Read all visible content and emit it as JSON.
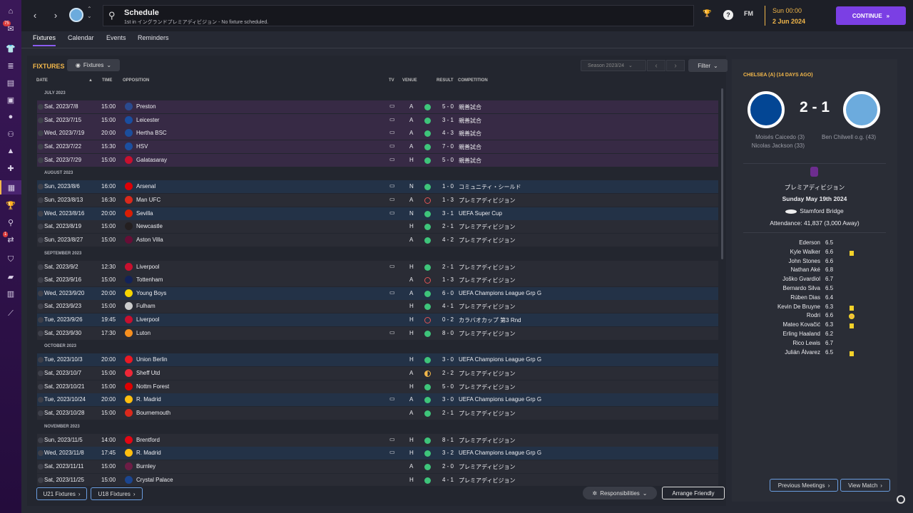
{
  "sidebar": {
    "items": [
      {
        "icon": "home-icon",
        "glyph": "⌂"
      },
      {
        "icon": "inbox-icon",
        "glyph": "✉",
        "badge": "75"
      },
      {
        "icon": "squad-icon",
        "glyph": "👕"
      },
      {
        "icon": "tactics-icon",
        "glyph": "≣"
      },
      {
        "icon": "data-hub-icon",
        "glyph": "▤"
      },
      {
        "icon": "staff-icon",
        "glyph": "▣"
      },
      {
        "icon": "training-icon",
        "glyph": "●"
      },
      {
        "icon": "recruitment-icon",
        "glyph": "⚇"
      },
      {
        "icon": "medical-icon",
        "glyph": "▲"
      },
      {
        "icon": "dev-center-icon",
        "glyph": "✚"
      },
      {
        "icon": "schedule-icon",
        "glyph": "▦",
        "active": true
      },
      {
        "icon": "competitions-icon",
        "glyph": "🏆"
      },
      {
        "icon": "scouting-icon",
        "glyph": "⚲"
      },
      {
        "icon": "transfers-icon",
        "glyph": "⇄",
        "badge": "1"
      },
      {
        "icon": "club-info-icon",
        "glyph": "⛉"
      },
      {
        "icon": "finances-icon",
        "glyph": "▰"
      },
      {
        "icon": "club-vision-icon",
        "glyph": "▥"
      },
      {
        "icon": "tutorial-icon",
        "glyph": "⟋"
      }
    ]
  },
  "topbar": {
    "title": "Schedule",
    "subtitle": "1st in イングランドプレミアディビジョン - No fixture scheduled.",
    "fm_label": "FM",
    "time": "Sun 00:00",
    "date": "2 Jun 2024",
    "continue_label": "CONTINUE"
  },
  "tabs": [
    {
      "label": "Fixtures",
      "active": true
    },
    {
      "label": "Calendar"
    },
    {
      "label": "Events"
    },
    {
      "label": "Reminders"
    }
  ],
  "fixtures": {
    "title": "FIXTURES",
    "view_dropdown": "Fixtures",
    "season": "Season 2023/24",
    "filter_label": "Filter",
    "columns": {
      "date": "DATE",
      "time": "TIME",
      "opposition": "OPPOSITION",
      "tv": "TV",
      "venue": "VENUE",
      "result": "RESULT",
      "competition": "COMPETITION"
    },
    "rows": [
      {
        "type": "month",
        "label": "JULY 2023"
      },
      {
        "date": "Sat, 2023/7/8",
        "time": "15:00",
        "opp": "Preston",
        "tv": true,
        "venue": "A",
        "res": "W",
        "score": "5 - 0",
        "comp": "親善試合",
        "cat": "pre",
        "crest": "#2b4a8e"
      },
      {
        "date": "Sat, 2023/7/15",
        "time": "15:00",
        "opp": "Leicester",
        "tv": true,
        "venue": "A",
        "res": "W",
        "score": "3 - 1",
        "comp": "親善試合",
        "cat": "pre",
        "crest": "#1a4ea0"
      },
      {
        "date": "Wed, 2023/7/19",
        "time": "20:00",
        "opp": "Hertha BSC",
        "tv": true,
        "venue": "A",
        "res": "W",
        "score": "4 - 3",
        "comp": "親善試合",
        "cat": "pre",
        "crest": "#1c4e9c"
      },
      {
        "date": "Sat, 2023/7/22",
        "time": "15:30",
        "opp": "HSV",
        "tv": true,
        "venue": "A",
        "res": "W",
        "score": "7 - 0",
        "comp": "親善試合",
        "cat": "pre",
        "crest": "#1c4fa0"
      },
      {
        "date": "Sat, 2023/7/29",
        "time": "15:00",
        "opp": "Galatasaray",
        "tv": true,
        "venue": "H",
        "res": "W",
        "score": "5 - 0",
        "comp": "親善試合",
        "cat": "pre",
        "crest": "#c8102e"
      },
      {
        "type": "month",
        "label": "AUGUST 2023"
      },
      {
        "date": "Sun, 2023/8/6",
        "time": "16:00",
        "opp": "Arsenal",
        "tv": true,
        "venue": "N",
        "res": "W",
        "score": "1 - 0",
        "comp": "コミュニティ・シールド",
        "cat": "cs",
        "crest": "#db0007"
      },
      {
        "date": "Sun, 2023/8/13",
        "time": "16:30",
        "opp": "Man UFC",
        "tv": true,
        "venue": "A",
        "res": "L",
        "score": "1 - 3",
        "comp": "プレミアディビジョン",
        "cat": "def",
        "crest": "#da291c"
      },
      {
        "date": "Wed, 2023/8/16",
        "time": "20:00",
        "opp": "Sevilla",
        "tv": true,
        "venue": "N",
        "res": "W",
        "score": "3 - 1",
        "comp": "UEFA Super Cup",
        "cat": "cs",
        "crest": "#d81e05"
      },
      {
        "date": "Sat, 2023/8/19",
        "time": "15:00",
        "opp": "Newcastle",
        "tv": false,
        "venue": "H",
        "res": "W",
        "score": "2 - 1",
        "comp": "プレミアディビジョン",
        "cat": "def",
        "crest": "#241f20"
      },
      {
        "date": "Sun, 2023/8/27",
        "time": "15:00",
        "opp": "Aston Villa",
        "tv": false,
        "venue": "A",
        "res": "W",
        "score": "4 - 2",
        "comp": "プレミアディビジョン",
        "cat": "def",
        "crest": "#670e36"
      },
      {
        "type": "month",
        "label": "SEPTEMBER 2023"
      },
      {
        "date": "Sat, 2023/9/2",
        "time": "12:30",
        "opp": "Liverpool",
        "tv": true,
        "venue": "H",
        "res": "W",
        "score": "2 - 1",
        "comp": "プレミアディビジョン",
        "cat": "def",
        "crest": "#c8102e"
      },
      {
        "date": "Sat, 2023/9/16",
        "time": "15:00",
        "opp": "Tottenham",
        "tv": false,
        "venue": "A",
        "res": "L",
        "score": "1 - 3",
        "comp": "プレミアディビジョン",
        "cat": "def",
        "crest": "#132257"
      },
      {
        "date": "Wed, 2023/9/20",
        "time": "20:00",
        "opp": "Young Boys",
        "tv": true,
        "venue": "A",
        "res": "W",
        "score": "6 - 0",
        "comp": "UEFA Champions League Grp G",
        "cat": "cs",
        "crest": "#f6d500"
      },
      {
        "date": "Sat, 2023/9/23",
        "time": "15:00",
        "opp": "Fulham",
        "tv": false,
        "venue": "H",
        "res": "W",
        "score": "4 - 1",
        "comp": "プレミアディビジョン",
        "cat": "def",
        "crest": "#cccccc"
      },
      {
        "date": "Tue, 2023/9/26",
        "time": "19:45",
        "opp": "Liverpool",
        "tv": false,
        "venue": "H",
        "res": "L",
        "score": "0 - 2",
        "comp": "カラバオカップ 第3 Rnd",
        "cat": "cs",
        "crest": "#c8102e"
      },
      {
        "date": "Sat, 2023/9/30",
        "time": "17:30",
        "opp": "Luton",
        "tv": true,
        "venue": "H",
        "res": "W",
        "score": "8 - 0",
        "comp": "プレミアディビジョン",
        "cat": "def",
        "crest": "#f78f1e"
      },
      {
        "type": "month",
        "label": "OCTOBER 2023"
      },
      {
        "date": "Tue, 2023/10/3",
        "time": "20:00",
        "opp": "Union Berlin",
        "tv": false,
        "venue": "H",
        "res": "W",
        "score": "3 - 0",
        "comp": "UEFA Champions League Grp G",
        "cat": "cs",
        "crest": "#eb1923"
      },
      {
        "date": "Sat, 2023/10/7",
        "time": "15:00",
        "opp": "Sheff Utd",
        "tv": false,
        "venue": "A",
        "res": "D",
        "score": "2 - 2",
        "comp": "プレミアディビジョン",
        "cat": "def",
        "crest": "#ee2737"
      },
      {
        "date": "Sat, 2023/10/21",
        "time": "15:00",
        "opp": "Nottm Forest",
        "tv": false,
        "venue": "H",
        "res": "W",
        "score": "5 - 0",
        "comp": "プレミアディビジョン",
        "cat": "def",
        "crest": "#dd0000"
      },
      {
        "date": "Tue, 2023/10/24",
        "time": "20:00",
        "opp": "R. Madrid",
        "tv": true,
        "venue": "A",
        "res": "W",
        "score": "3 - 0",
        "comp": "UEFA Champions League Grp G",
        "cat": "cs",
        "crest": "#febe10"
      },
      {
        "date": "Sat, 2023/10/28",
        "time": "15:00",
        "opp": "Bournemouth",
        "tv": false,
        "venue": "A",
        "res": "W",
        "score": "2 - 1",
        "comp": "プレミアディビジョン",
        "cat": "def",
        "crest": "#da291c"
      },
      {
        "type": "month",
        "label": "NOVEMBER 2023"
      },
      {
        "date": "Sun, 2023/11/5",
        "time": "14:00",
        "opp": "Brentford",
        "tv": true,
        "venue": "H",
        "res": "W",
        "score": "8 - 1",
        "comp": "プレミアディビジョン",
        "cat": "def",
        "crest": "#e30613"
      },
      {
        "date": "Wed, 2023/11/8",
        "time": "17:45",
        "opp": "R. Madrid",
        "tv": true,
        "venue": "H",
        "res": "W",
        "score": "3 - 2",
        "comp": "UEFA Champions League Grp G",
        "cat": "cs",
        "crest": "#febe10"
      },
      {
        "date": "Sat, 2023/11/11",
        "time": "15:00",
        "opp": "Burnley",
        "tv": false,
        "venue": "A",
        "res": "W",
        "score": "2 - 0",
        "comp": "プレミアディビジョン",
        "cat": "def",
        "crest": "#6c1d45"
      },
      {
        "date": "Sat, 2023/11/25",
        "time": "15:00",
        "opp": "Crystal Palace",
        "tv": false,
        "venue": "H",
        "res": "W",
        "score": "4 - 1",
        "comp": "プレミアディビジョン",
        "cat": "def",
        "crest": "#1b458f"
      }
    ],
    "u21_label": "U21 Fixtures",
    "u18_label": "U18 Fixtures",
    "responsibilities_label": "Responsibilities",
    "arrange_label": "Arrange Friendly"
  },
  "last_match": {
    "title": "CHELSEA (A) (14 DAYS AGO)",
    "score": "2 - 1",
    "home_scorers": [
      "Moisés Caicedo (3)",
      "Nicolas Jackson (33)"
    ],
    "away_scorers": [
      "Ben Chilwell o.g. (43)"
    ],
    "competition": "プレミアディビジョン",
    "date": "Sunday May 19th 2024",
    "stadium": "Stamford Bridge",
    "attendance": "Attendance: 41,837 (3,000 Away)",
    "players": [
      {
        "name": "Ederson",
        "rating": "6.5"
      },
      {
        "name": "Kyle Walker",
        "rating": "6.6",
        "card": "yellow"
      },
      {
        "name": "John Stones",
        "rating": "6.6"
      },
      {
        "name": "Nathan Aké",
        "rating": "6.8"
      },
      {
        "name": "Joško Gvardiol",
        "rating": "6.7"
      },
      {
        "name": "Bernardo Silva",
        "rating": "6.5"
      },
      {
        "name": "Rúben Dias",
        "rating": "6.4"
      },
      {
        "name": "Kevin De Bruyne",
        "rating": "6.3",
        "card": "yellow"
      },
      {
        "name": "Rodri",
        "rating": "6.6",
        "card": "mom"
      },
      {
        "name": "Mateo Kovačić",
        "rating": "6.3",
        "card": "yellow"
      },
      {
        "name": "Erling Haaland",
        "rating": "6.2"
      },
      {
        "name": "Rico Lewis",
        "rating": "6.7"
      },
      {
        "name": "Julián Álvarez",
        "rating": "6.5",
        "card": "yellow"
      }
    ],
    "prev_meetings_label": "Previous Meetings",
    "view_match_label": "View Match"
  },
  "colors": {
    "accent": "#7b3fe4",
    "highlight": "#f2b74a",
    "win": "#3ec47a",
    "loss": "#e05454",
    "preseason_row": "#372a45",
    "cup_row": "#233247"
  }
}
